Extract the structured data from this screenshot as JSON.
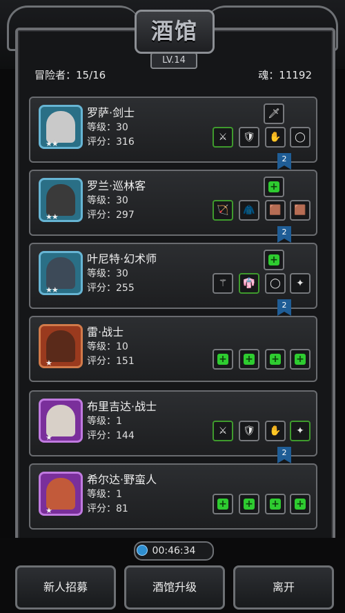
{
  "header": {
    "title": "酒馆",
    "level": "LV.14"
  },
  "stats": {
    "adventurers": "冒险者：15/16",
    "soul": "魂：11192"
  },
  "heroes": [
    {
      "name": "罗萨·剑士",
      "level": "等级：30",
      "score": "评分：316",
      "stars": "★★",
      "ribbon": "2",
      "color": "#2a6f86"
    },
    {
      "name": "罗兰·巡林客",
      "level": "等级：30",
      "score": "评分：297",
      "stars": "★★",
      "ribbon": "2",
      "color": "#2a6f86"
    },
    {
      "name": "叶尼特·幻术师",
      "level": "等级：30",
      "score": "评分：255",
      "stars": "★★",
      "ribbon": "2",
      "color": "#2a6f86"
    },
    {
      "name": "雷·战士",
      "level": "等级：10",
      "score": "评分：151",
      "stars": "★",
      "ribbon": "",
      "color": "#9a3a1e"
    },
    {
      "name": "布里吉达·战士",
      "level": "等级：1",
      "score": "评分：144",
      "stars": "★",
      "ribbon": "2",
      "color": "#7a2f9b"
    },
    {
      "name": "希尔达·野蛮人",
      "level": "等级：1",
      "score": "评分：81",
      "stars": "★",
      "ribbon": "",
      "color": "#7a2f9b"
    }
  ],
  "timer": "00:46:34",
  "buttons": {
    "recruit": "新人招募",
    "upgrade": "酒馆升级",
    "leave": "离开"
  }
}
